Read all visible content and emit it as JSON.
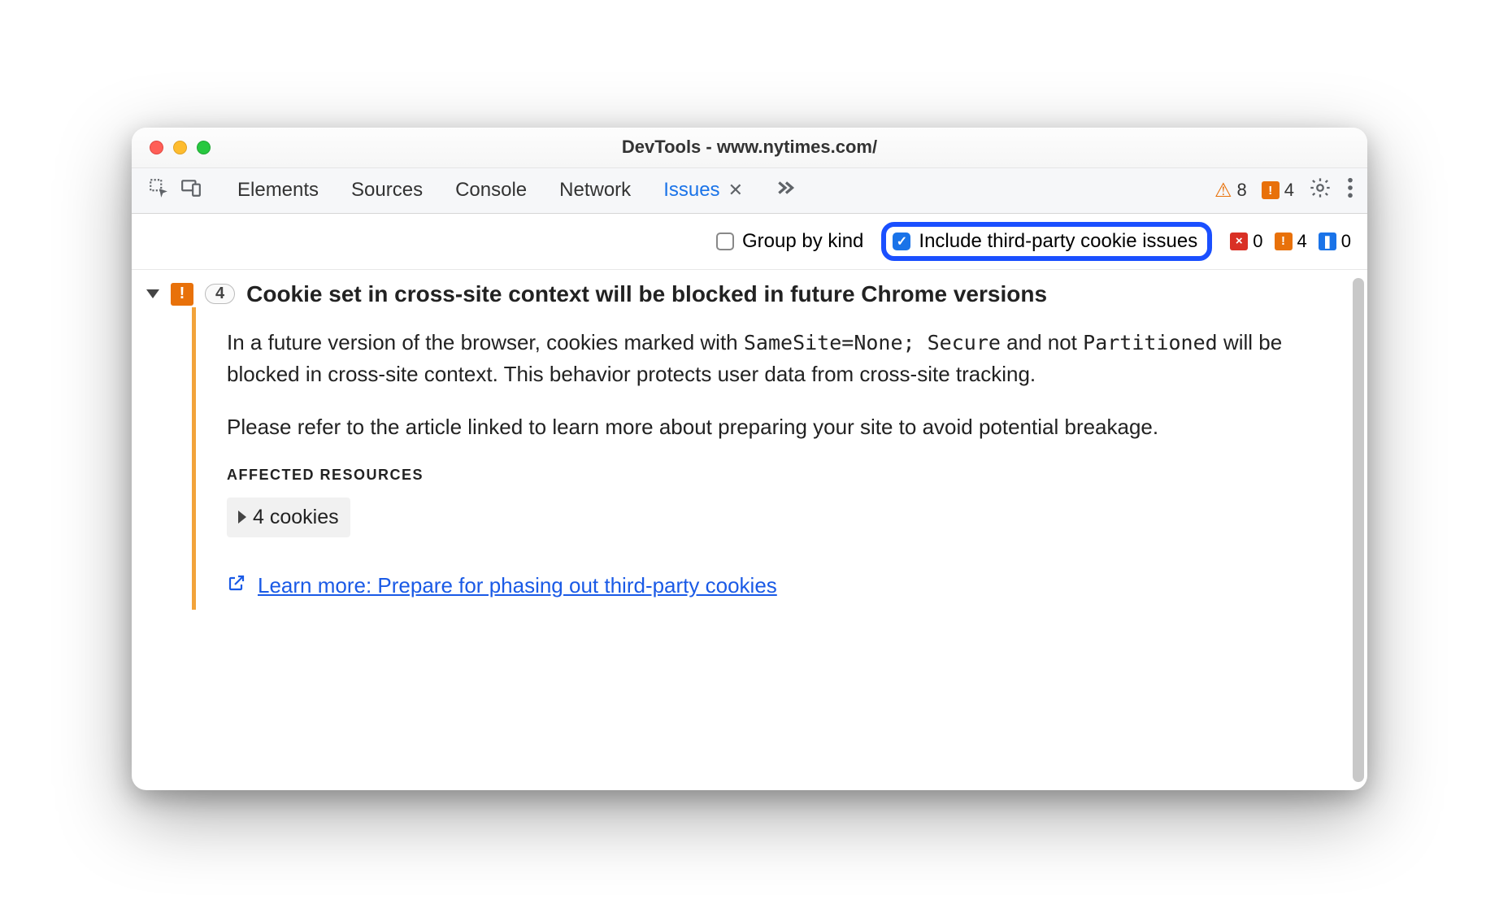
{
  "window": {
    "title": "DevTools - www.nytimes.com/"
  },
  "toolbar": {
    "tabs": [
      "Elements",
      "Sources",
      "Console",
      "Network"
    ],
    "active_tab": "Issues",
    "error_count": "8",
    "breaking_count": "4"
  },
  "filterbar": {
    "group_label": "Group by kind",
    "include_label": "Include third-party cookie issues",
    "counts": {
      "red": "0",
      "orange": "4",
      "blue": "0"
    }
  },
  "issue": {
    "count": "4",
    "title": "Cookie set in cross-site context will be blocked in future Chrome versions",
    "para1_a": "In a future version of the browser, cookies marked with ",
    "code1": "SameSite=None; Secure",
    "para1_b": " and not ",
    "code2": "Partitioned",
    "para1_c": " will be blocked in cross-site context. This behavior protects user data from cross-site tracking.",
    "para2": "Please refer to the article linked to learn more about preparing your site to avoid potential breakage.",
    "affected_title": "AFFECTED RESOURCES",
    "cookies_label": "4 cookies",
    "learn_label": "Learn more: Prepare for phasing out third-party cookies"
  }
}
